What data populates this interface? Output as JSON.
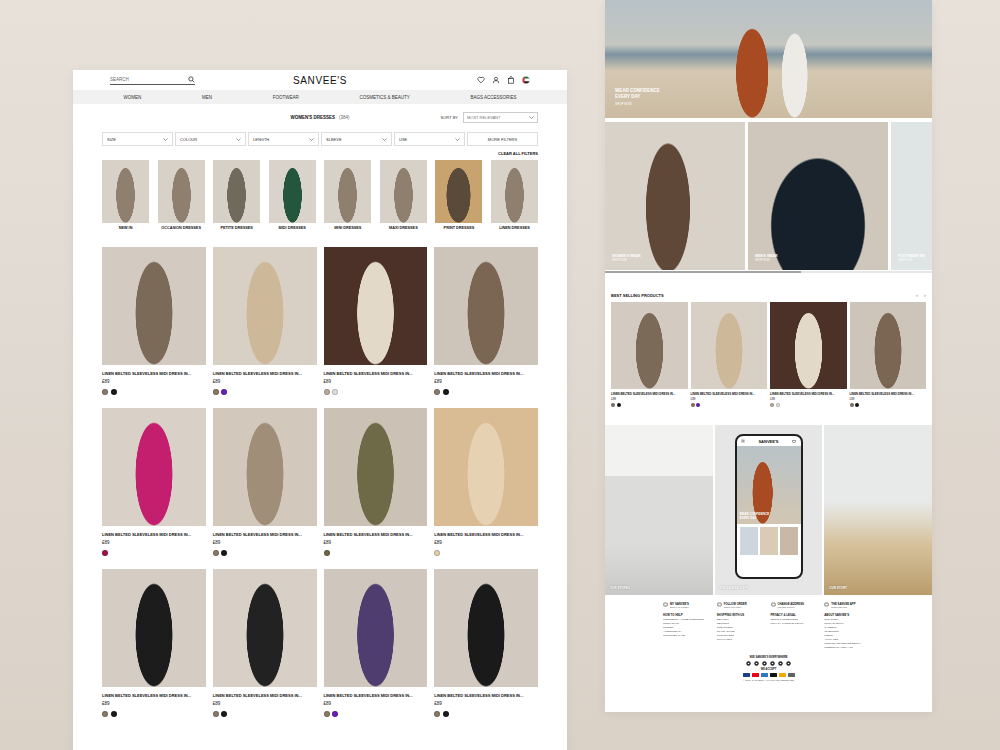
{
  "header": {
    "search_placeholder": "SEARCH",
    "logo": "SANVEE'S"
  },
  "nav": [
    "WOMEN",
    "MEN",
    "FOOTWEAR",
    "COSMETICS & BEAUTY",
    "BAGS ACCESSORIES"
  ],
  "listing": {
    "title": "WOMEN'S DRESSES",
    "count": "(384)",
    "sort_label": "SORT BY",
    "sort_value": "MOST RELEVANT"
  },
  "filters": [
    "SIZE",
    "COLOUR",
    "LENGTH",
    "SLEEVE",
    "USE"
  ],
  "more_filters": "MORE FILTERS",
  "clear_filters": "CLEAR ALL FILTERS",
  "categories": [
    "NEW IN",
    "OCCASION DRESSES",
    "PETITE DRESSES",
    "MIDI DRESSES",
    "MINI DRESSES",
    "MAXI DRESSES",
    "PRINT DRESSES",
    "LINEN DRESSES"
  ],
  "products": [
    {
      "name": "LINEN BELTED SLEEVELESS MIDI DRESS IN...",
      "price": "£89",
      "swatches": [
        {
          "color": "#8c7a68"
        },
        {
          "color": "#1a1a1a"
        }
      ]
    },
    {
      "name": "LINEN BELTED SLEEVELESS MIDI DRESS IN...",
      "price": "£89",
      "swatches": [
        {
          "color": "#8c7a68"
        },
        {
          "color": "#6a1fb8"
        }
      ]
    },
    {
      "name": "LINEN BELTED SLEEVELESS MIDI DRESS IN...",
      "price": "£89",
      "swatches": [
        {
          "color": "#b9ad9c"
        },
        {
          "color": "#e2e0dc"
        }
      ]
    },
    {
      "name": "LINEN BELTED SLEEVELESS MIDI DRESS IN...",
      "price": "£89",
      "swatches": [
        {
          "color": "#8c7a68"
        },
        {
          "color": "#1a1a1a"
        }
      ]
    },
    {
      "name": "LINEN BELTED SLEEVELESS MIDI DRESS IN...",
      "price": "£89",
      "swatches": [
        {
          "color": "#a0124a"
        }
      ]
    },
    {
      "name": "LINEN BELTED SLEEVELESS MIDI DRESS IN...",
      "price": "£89",
      "swatches": [
        {
          "color": "#8c7a68"
        },
        {
          "color": "#1a1a1a"
        }
      ]
    },
    {
      "name": "LINEN BELTED SLEEVELESS MIDI DRESS IN...",
      "price": "£89",
      "swatches": [
        {
          "color": "#6e6a48"
        }
      ]
    },
    {
      "name": "LINEN BELTED SLEEVELESS MIDI DRESS IN...",
      "price": "£89",
      "swatches": [
        {
          "color": "#e3cfb2"
        }
      ]
    },
    {
      "name": "LINEN BELTED SLEEVELESS MIDI DRESS IN...",
      "price": "£89",
      "swatches": [
        {
          "color": "#8c7a68"
        },
        {
          "color": "#1a1a1a"
        }
      ]
    },
    {
      "name": "LINEN BELTED SLEEVELESS MIDI DRESS IN...",
      "price": "£89",
      "swatches": [
        {
          "color": "#8c7a68"
        },
        {
          "color": "#1a1a1a"
        }
      ]
    },
    {
      "name": "LINEN BELTED SLEEVELESS MIDI DRESS IN...",
      "price": "£89",
      "swatches": [
        {
          "color": "#8c7a68"
        },
        {
          "color": "#6a1fb8"
        }
      ]
    },
    {
      "name": "LINEN BELTED SLEEVELESS MIDI DRESS IN...",
      "price": "£89",
      "swatches": [
        {
          "color": "#8c7a68"
        },
        {
          "color": "#1a1a1a"
        }
      ]
    }
  ],
  "home": {
    "hero": {
      "title": "WEAR CONFIDENCE EVERY DAY",
      "link": "SHOP NOW"
    },
    "collections": [
      {
        "label": "WOMEN'S WEAR",
        "link": "SHOP NOW"
      },
      {
        "label": "MEN'S WEAR",
        "link": "SHOP NOW"
      },
      {
        "label": "FOOTWEAR WE",
        "link": "SHOP NOW"
      }
    ],
    "scroll": {
      "level": 0.6
    },
    "best_selling": {
      "title": "BEST SELLING PRODUCTS",
      "prev": "‹",
      "next": "›",
      "products": [
        {
          "name": "LINEN BELTED SLEEVELESS MIDI DRESS IN...",
          "price": "£89",
          "swatches": [
            {
              "color": "#8c7a68"
            },
            {
              "color": "#1a1a1a"
            }
          ]
        },
        {
          "name": "LINEN BELTED SLEEVELESS MIDI DRESS IN...",
          "price": "£89",
          "swatches": [
            {
              "color": "#8c7a68"
            },
            {
              "color": "#6a1fb8"
            }
          ]
        },
        {
          "name": "LINEN BELTED SLEEVELESS MIDI DRESS IN...",
          "price": "£89",
          "swatches": [
            {
              "color": "#b9ad9c"
            },
            {
              "color": "#e2e0dc"
            }
          ]
        },
        {
          "name": "LINEN BELTED SLEEVELESS MIDI DRESS IN...",
          "price": "£89",
          "swatches": [
            {
              "color": "#8c7a68"
            },
            {
              "color": "#1a1a1a"
            }
          ]
        }
      ]
    },
    "panels": [
      {
        "label": "OUR STORES",
        "kind": "photo"
      },
      {
        "label": "THE SANVEE'S APP",
        "kind": "app"
      },
      {
        "label": "OUR STORY",
        "kind": "photo"
      }
    ],
    "phone": {
      "logo": "SANVEE'S",
      "banner": "WEAR CONFIDENCE EVERY DAY"
    },
    "footer": {
      "features": [
        {
          "title": "MY SANVEE'S",
          "text": "Sign in or register"
        },
        {
          "title": "FOLLOW ORDER",
          "text": "Track your order"
        },
        {
          "title": "CHANGE ADDRESS",
          "text": "Manage delivery"
        },
        {
          "title": "THE SANVEE APP",
          "text": "Download now"
        }
      ],
      "columns": [
        {
          "title": "HOW TO HELP",
          "links": [
            "FREQUENTLY ASKED QUESTIONS",
            "CONTACT US",
            "STORES",
            "ACCESSIBILITY",
            "CUSTOMER CARE"
          ]
        },
        {
          "title": "SHOPPING WITH US",
          "links": [
            "DELIVERY",
            "RETURNS",
            "SIZE GUIDES",
            "STYLE ADVICE",
            "PROMOTIONS",
            "GIFT CARDS"
          ]
        },
        {
          "title": "PRIVACY & LEGAL",
          "links": [
            "TERMS & CONDITIONS",
            "PRIVACY & COOKIE POLICY"
          ]
        },
        {
          "title": "ABOUT SANVEE'S",
          "links": [
            "OUR STORY",
            "SUSTAINABILITY",
            "CAREERS",
            "INVESTORS",
            "PRESS",
            "AFFILIATES",
            "CORPORATE RESPONSIBILITY",
            "MODERN SLAVERY ACT"
          ]
        }
      ],
      "social_title": "SEE SANVEE'S EVERYWHERE",
      "payments_title": "WE ACCEPT",
      "copyright": "© 2024 SANVEE'S. ALL RIGHTS RESERVED"
    }
  }
}
